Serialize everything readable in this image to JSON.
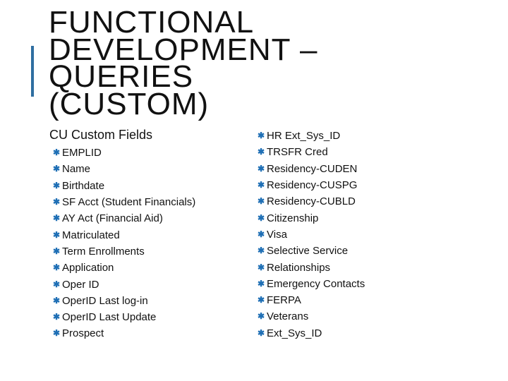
{
  "slide": {
    "accent_color": "#2f6ea1",
    "bullet_color": "#1f6fb5",
    "bullet_icon": "asterisk-icon",
    "title_lines": [
      "FUNCTIONAL",
      "DEVELOPMENT –",
      "QUERIES",
      "(CUSTOM)"
    ],
    "subheading": "CU Custom Fields",
    "left_items": [
      "EMPLID",
      "Name",
      "Birthdate",
      "SF Acct (Student Financials)",
      "AY Act (Financial Aid)",
      "Matriculated",
      "Term Enrollments",
      "Application",
      "Oper ID",
      "OperID Last log-in",
      "OperID Last Update",
      "Prospect"
    ],
    "right_items": [
      "HR Ext_Sys_ID",
      "TRSFR Cred",
      "Residency-CUDEN",
      "Residency-CUSPG",
      "Residency-CUBLD",
      "Citizenship",
      "Visa",
      "Selective Service",
      "Relationships",
      "Emergency Contacts",
      "FERPA",
      "Veterans",
      "Ext_Sys_ID"
    ]
  }
}
